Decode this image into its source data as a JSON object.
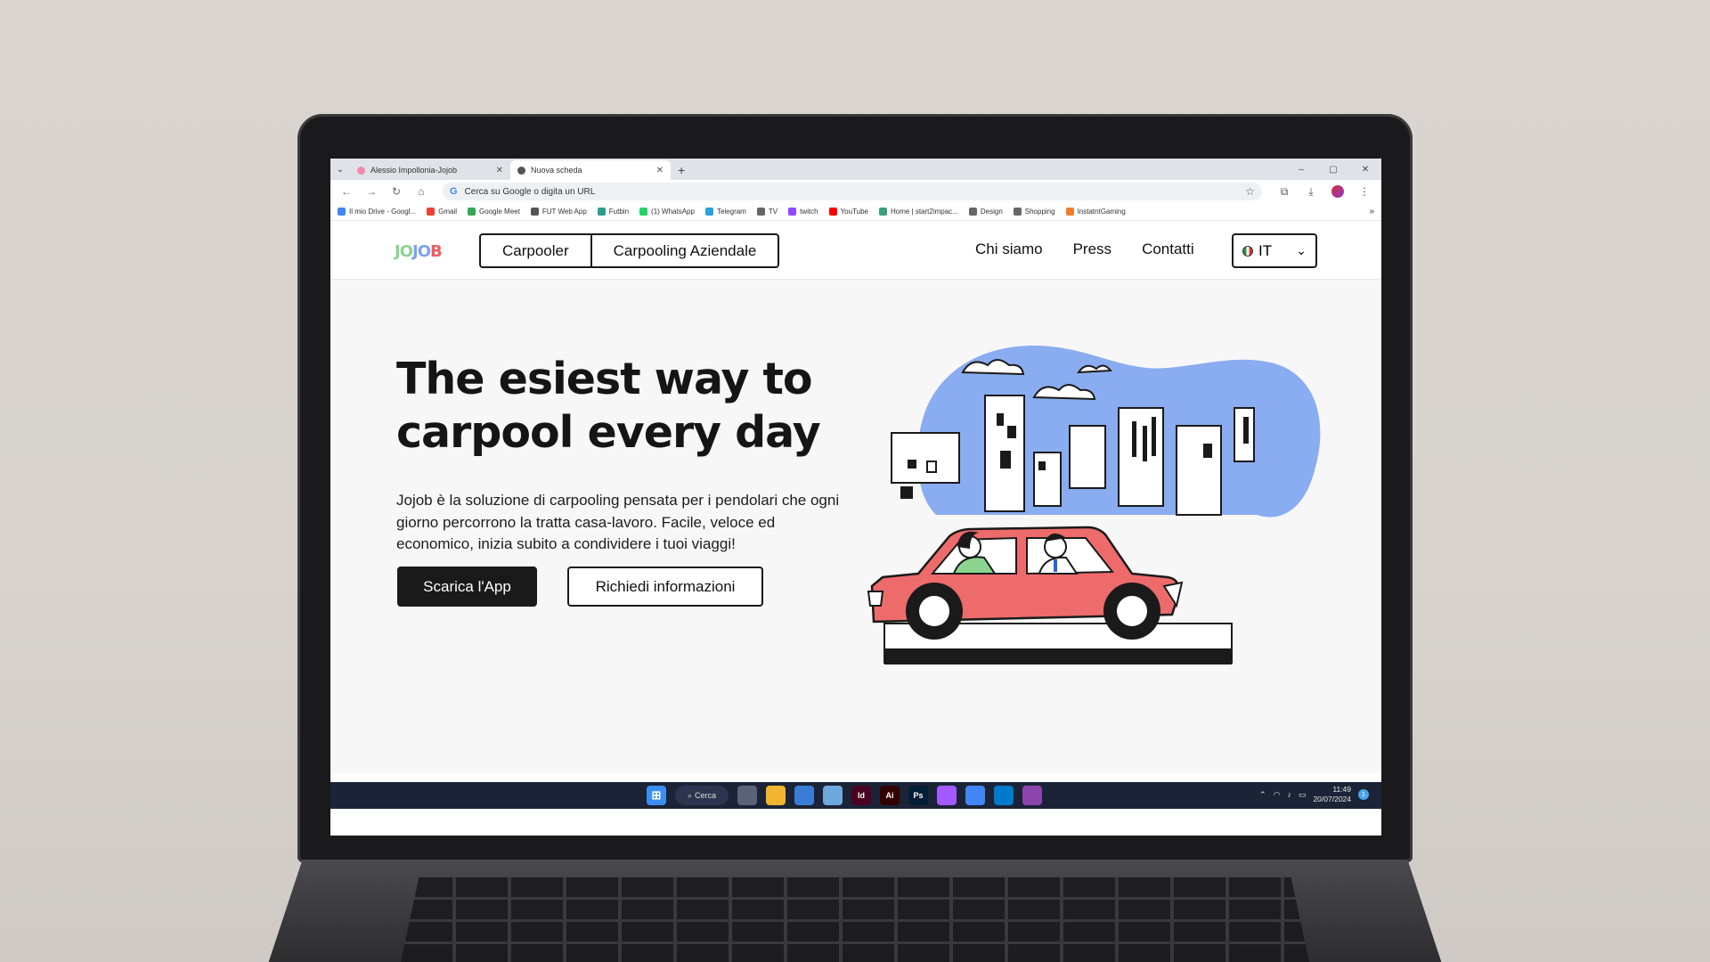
{
  "browser": {
    "tabs": [
      {
        "title": "Alessio Impollonia-Jojob",
        "active": false
      },
      {
        "title": "Nuova scheda",
        "active": true
      }
    ],
    "new_tab_label": "+",
    "window_controls": [
      "–",
      "▢",
      "✕"
    ],
    "address_placeholder": "Cerca su Google o digita un URL",
    "bookmarks": [
      {
        "label": "Il mio Drive - Googl...",
        "color": "#4285f4"
      },
      {
        "label": "Gmail",
        "color": "#ea4335"
      },
      {
        "label": "Google Meet",
        "color": "#34a853"
      },
      {
        "label": "FUT Web App",
        "color": "#555555"
      },
      {
        "label": "Futbin",
        "color": "#2a9d8f"
      },
      {
        "label": "(1) WhatsApp",
        "color": "#25d366"
      },
      {
        "label": "Telegram",
        "color": "#2aa1da"
      },
      {
        "label": "TV",
        "color": "#666666"
      },
      {
        "label": "twitch",
        "color": "#9146ff"
      },
      {
        "label": "YouTube",
        "color": "#ff0000"
      },
      {
        "label": "Home | start2impac...",
        "color": "#3aa17e"
      },
      {
        "label": "Design",
        "color": "#666666"
      },
      {
        "label": "Shopping",
        "color": "#666666"
      },
      {
        "label": "InstatntGaming",
        "color": "#f07d2a"
      }
    ],
    "bookmarks_more": "»"
  },
  "site": {
    "logo": {
      "part1": "JO",
      "part2": "JO",
      "part3": "B"
    },
    "segment": {
      "left": "Carpooler",
      "right": "Carpooling Aziendale"
    },
    "menu": [
      "Chi siamo",
      "Press",
      "Contatti"
    ],
    "language": "IT",
    "hero": {
      "title": "The esiest way to carpool every day",
      "subtitle": "Jojob è la soluzione di carpooling pensata per i pendolari che ogni giorno percorrono la tratta casa-lavoro. Facile, veloce ed economico, inizia subito a condividere i tuoi viaggi!",
      "primary_cta": "Scarica l'App",
      "secondary_cta": "Richiedi informazioni"
    },
    "colors": {
      "sky": "#8aacf0",
      "car": "#ee6b6b",
      "dark": "#1a1a1a",
      "green": "#8bd58f"
    }
  },
  "taskbar": {
    "search_label": "Cerca",
    "apps": [
      {
        "name": "task-view",
        "label": "",
        "color": "#5a6275"
      },
      {
        "name": "explorer",
        "label": "",
        "color": "#f2b531"
      },
      {
        "name": "store",
        "label": "",
        "color": "#3a7bd5"
      },
      {
        "name": "photos",
        "label": "",
        "color": "#6fa8dc"
      },
      {
        "name": "indesign",
        "label": "Id",
        "color": "#49021f"
      },
      {
        "name": "illustrator",
        "label": "Ai",
        "color": "#330000"
      },
      {
        "name": "photoshop",
        "label": "Ps",
        "color": "#001e36"
      },
      {
        "name": "figma",
        "label": "",
        "color": "#a259ff"
      },
      {
        "name": "chrome",
        "label": "",
        "color": "#4285f4"
      },
      {
        "name": "vscode",
        "label": "",
        "color": "#007acc"
      },
      {
        "name": "winrar",
        "label": "",
        "color": "#8e44ad"
      }
    ],
    "time": "11:49",
    "date": "20/07/2024",
    "notifications": "1"
  }
}
